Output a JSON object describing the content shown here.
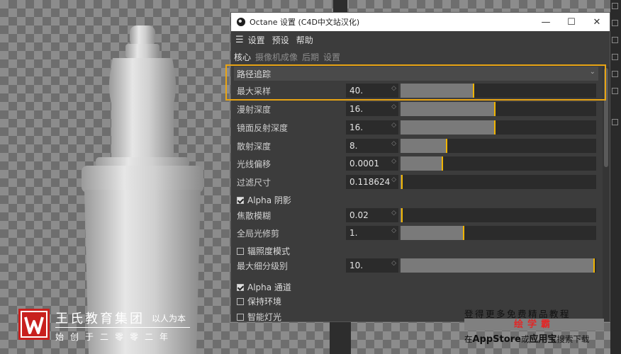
{
  "window": {
    "title": "Octane 设置 (C4D中文站汉化)",
    "minimize": "—",
    "maximize": "☐",
    "close": "✕"
  },
  "menu": {
    "items": [
      "设置",
      "预设",
      "帮助"
    ]
  },
  "tabs": [
    {
      "label": "核心",
      "active": true
    },
    {
      "label": "摄像机成像",
      "active": false
    },
    {
      "label": "后期",
      "active": false
    },
    {
      "label": "设置",
      "active": false
    }
  ],
  "kernel": {
    "selected": "路径追踪"
  },
  "params": {
    "max_samples": {
      "label": "最大采样",
      "value": "40.",
      "fill": 0.38
    },
    "diffuse_depth": {
      "label": "漫射深度",
      "value": "16.",
      "fill": 0.49
    },
    "specular_depth": {
      "label": "镜面反射深度",
      "value": "16.",
      "fill": 0.49
    },
    "scatter_depth": {
      "label": "散射深度",
      "value": "8.",
      "fill": 0.24
    },
    "ray_epsilon": {
      "label": "光线偏移",
      "value": "0.0001",
      "fill": 0.22
    },
    "filter_size": {
      "label": "过滤尺寸",
      "value": "0.118624",
      "fill": 0.01
    },
    "alpha_shadows": {
      "label": "Alpha 阴影",
      "checked": true
    },
    "dof_blur": {
      "label": "焦散模糊",
      "value": "0.02",
      "fill": 0.01
    },
    "gi_clamp": {
      "label": "全局光修剪",
      "value": "1.",
      "fill": 0.33
    },
    "irradiance": {
      "label": "辐照度模式",
      "checked": false
    },
    "max_subdiv": {
      "label": "最大细分级别",
      "value": "10.",
      "fill": 1.0
    },
    "alpha_channel": {
      "label": "Alpha 通道",
      "checked": true
    },
    "keep_env": {
      "label": "保持环境",
      "checked": false
    },
    "smart_light": {
      "label": "智能灯光",
      "checked": false
    }
  },
  "watermark": {
    "title": "王氏教育集团",
    "slogan": "以人为本",
    "sub": "始创于二零零二年"
  },
  "promo": {
    "line1": "登得更多免费精品教程",
    "banner": "绘学霸",
    "line2_a": "在",
    "line2_b": "AppStore",
    "line2_c": "或",
    "line2_d": "应用宝",
    "line2_e": "搜索下载"
  },
  "colors": {
    "accent": "#f0b400",
    "highlight": "#e8a414",
    "brand_red": "#c8201e"
  }
}
